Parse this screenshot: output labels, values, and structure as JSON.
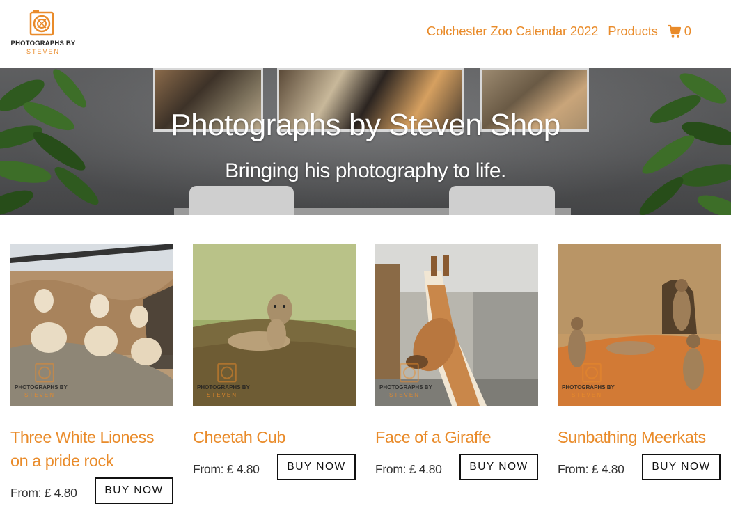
{
  "header": {
    "logo": {
      "line1": "PHOTOGRAPHS BY",
      "line2": "STEVEN",
      "icon": "camera-aperture-icon"
    },
    "nav": {
      "calendar": "Colchester Zoo Calendar 2022",
      "products": "Products",
      "cart_icon": "shopping-cart-icon",
      "cart_count": "0"
    }
  },
  "hero": {
    "title": "Photographs by Steven Shop",
    "subtitle": "Bringing his photography to life."
  },
  "watermark": {
    "line1": "PHOTOGRAPHS BY",
    "line2": "STEVEN"
  },
  "products": [
    {
      "title": "Three White Lioness on a pride rock",
      "price": "From: £ 4.80",
      "button": "BUY NOW"
    },
    {
      "title": "Cheetah Cub",
      "price": "From: £ 4.80",
      "button": "BUY NOW"
    },
    {
      "title": "Face of a Giraffe",
      "price": "From: £ 4.80",
      "button": "BUY NOW"
    },
    {
      "title": "Sunbathing Meerkats",
      "price": "From: £ 4.80",
      "button": "BUY NOW"
    }
  ],
  "colors": {
    "accent": "#e98b2a",
    "text": "#333333",
    "button_border": "#111111"
  }
}
